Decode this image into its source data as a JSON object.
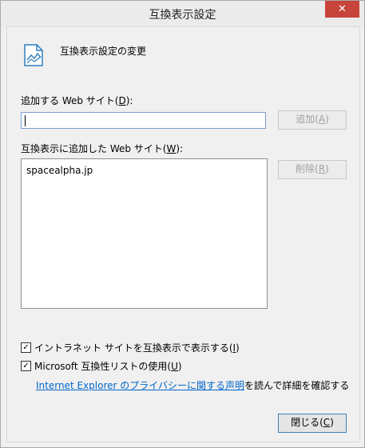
{
  "window": {
    "title": "互換表示設定",
    "close_glyph": "✕"
  },
  "header": {
    "icon": "compatibility-view-icon",
    "text": "互換表示設定の変更"
  },
  "add_site": {
    "label_before": "追加する Web サイト(",
    "label_key": "D",
    "label_after": "):",
    "input_value": "",
    "add_before": "追加(",
    "add_key": "A",
    "add_after": ")"
  },
  "added_sites": {
    "label_before": "互換表示に追加した Web サイト(",
    "label_key": "W",
    "label_after": "):",
    "items": [
      "spacealpha.jp"
    ],
    "remove_before": "削除(",
    "remove_key": "R",
    "remove_after": ")"
  },
  "options": [
    {
      "checked": true,
      "before": "イントラネット サイトを互換表示で表示する(",
      "key": "I",
      "after": ")"
    },
    {
      "checked": true,
      "before": "Microsoft 互換性リストの使用(",
      "key": "U",
      "after": ")"
    }
  ],
  "privacy": {
    "link_text": "Internet Explorer のプライバシーに関する声明",
    "suffix": "を読んで詳細を確認する"
  },
  "footer": {
    "close_before": "閉じる(",
    "close_key": "C",
    "close_after": ")"
  },
  "colors": {
    "link": "#0066cc",
    "close_button": "#c7443a",
    "input_border": "#7a9fd0"
  }
}
